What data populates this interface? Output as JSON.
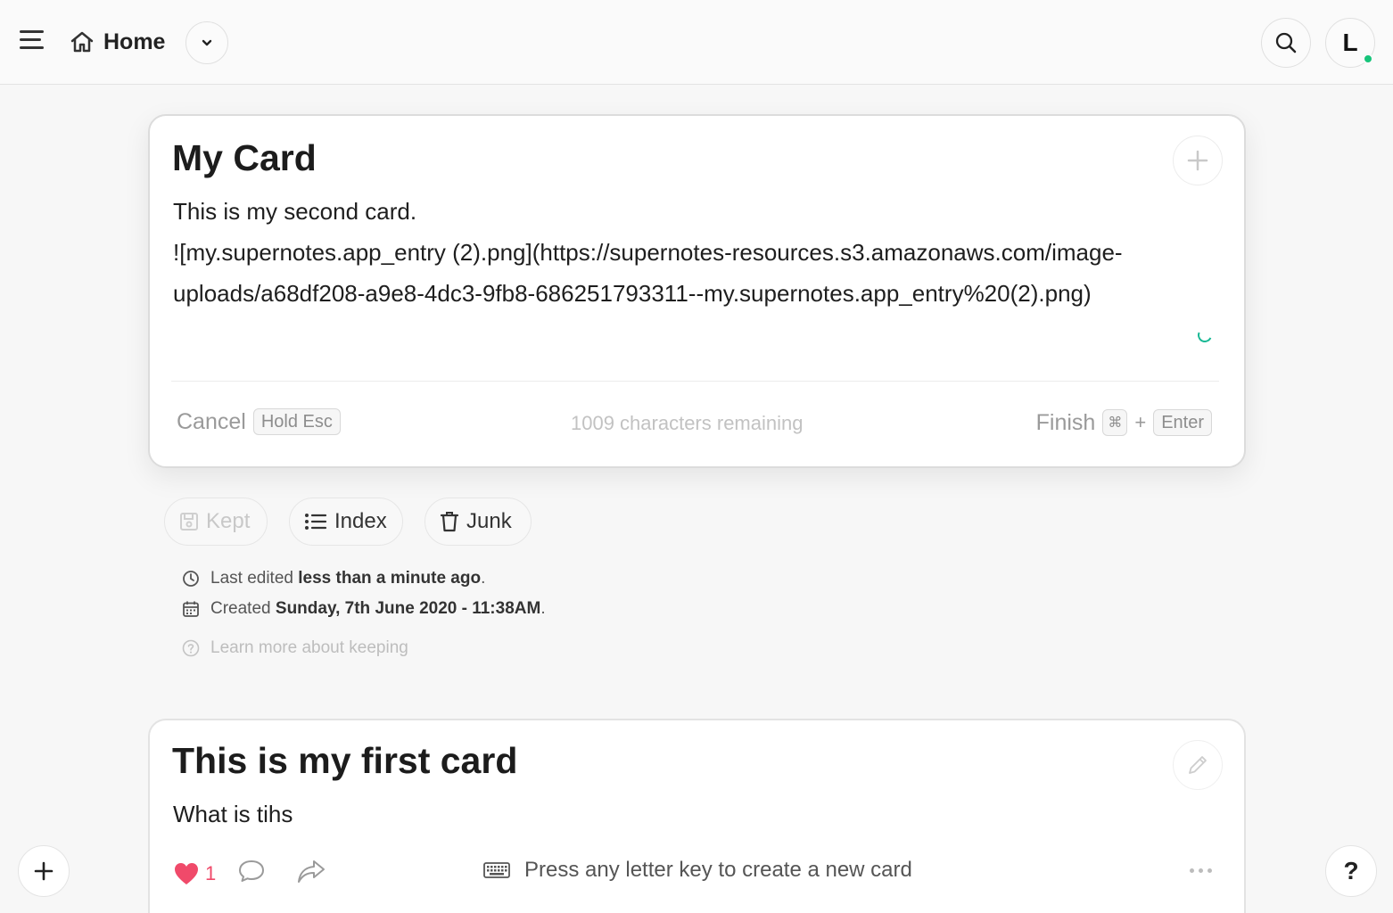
{
  "header": {
    "home_label": "Home",
    "avatar_initial": "L"
  },
  "edit_card": {
    "title": "My Card",
    "body_lines": [
      "This is my second card.",
      "![my.supernotes.app_entry (2).png](https://supernotes-resources.s3.amazonaws.com/image-",
      "uploads/a68df208-a9e8-4dc3-9fb8-686251793311--my.supernotes.app_entry%20(2).png)"
    ],
    "cancel_label": "Cancel",
    "cancel_key": "Hold Esc",
    "chars_remaining": "1009 characters remaining",
    "finish_label": "Finish",
    "finish_key_mod": "⌘",
    "finish_plus": "+",
    "finish_key": "Enter"
  },
  "pills": {
    "kept": "Kept",
    "index": "Index",
    "junk": "Junk"
  },
  "meta": {
    "edited_prefix": "Last edited",
    "edited_value": "less than a minute ago",
    "edited_suffix": ".",
    "created_prefix": "Created",
    "created_value": "Sunday, 7th June 2020 - 11:38AM",
    "created_suffix": ".",
    "learn_more": "Learn more about keeping"
  },
  "first_card": {
    "title": "This is my first card",
    "body": "What is tihs",
    "like_count": "1",
    "hint": "Press any letter key to create a new card"
  },
  "help_label": "?",
  "colors": {
    "online": "#16c47a",
    "like": "#f04a6a",
    "spinner": "#18b894"
  }
}
